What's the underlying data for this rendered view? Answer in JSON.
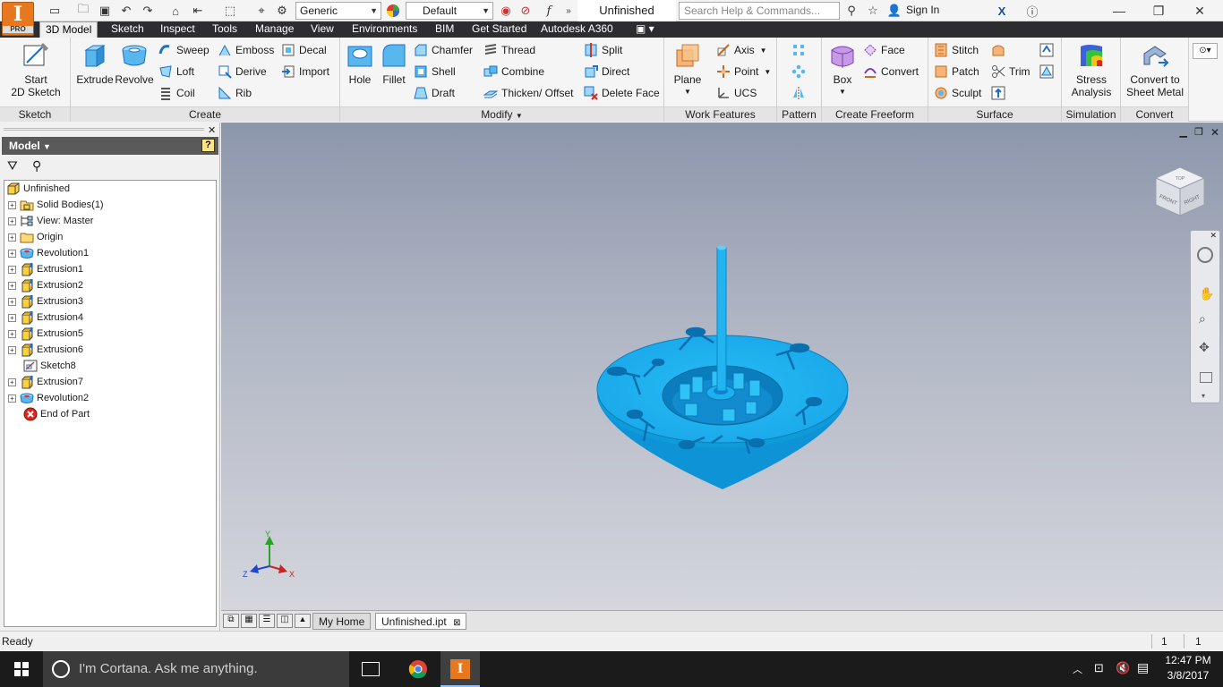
{
  "app": {
    "logo_letter": "I",
    "edition": "PRO"
  },
  "qat": {
    "material": "Generic",
    "appearance": "Default",
    "doc_title": "Unfinished",
    "help_placeholder": "Search Help & Commands...",
    "sign_in": "Sign In"
  },
  "tabs": [
    "3D Model",
    "Sketch",
    "Inspect",
    "Tools",
    "Manage",
    "View",
    "Environments",
    "BIM",
    "Get Started",
    "Autodesk A360"
  ],
  "ribbon": {
    "sketch": {
      "label": "Sketch",
      "start": "Start",
      "start2": "2D Sketch"
    },
    "create": {
      "label": "Create",
      "extrude": "Extrude",
      "revolve": "Revolve",
      "sweep": "Sweep",
      "loft": "Loft",
      "coil": "Coil",
      "emboss": "Emboss",
      "derive": "Derive",
      "rib": "Rib",
      "decal": "Decal",
      "import": "Import"
    },
    "modify": {
      "label": "Modify",
      "hole": "Hole",
      "fillet": "Fillet",
      "chamfer": "Chamfer",
      "shell": "Shell",
      "draft": "Draft",
      "thread": "Thread",
      "combine": "Combine",
      "thicken": "Thicken/ Offset",
      "split": "Split",
      "direct": "Direct",
      "delete_face": "Delete Face"
    },
    "work": {
      "label": "Work Features",
      "plane": "Plane",
      "axis": "Axis",
      "point": "Point",
      "ucs": "UCS"
    },
    "pattern": {
      "label": "Pattern"
    },
    "freeform": {
      "label": "Create Freeform",
      "box": "Box",
      "face": "Face",
      "convert": "Convert"
    },
    "surface": {
      "label": "Surface",
      "stitch": "Stitch",
      "patch": "Patch",
      "sculpt": "Sculpt",
      "trim": "Trim"
    },
    "simulation": {
      "label": "Simulation",
      "stress": "Stress",
      "stress2": "Analysis"
    },
    "convert": {
      "label": "Convert",
      "c1": "Convert to",
      "c2": "Sheet Metal"
    }
  },
  "browser": {
    "title": "Model",
    "root": "Unfinished",
    "nodes": [
      "Solid Bodies(1)",
      "View: Master",
      "Origin",
      "Revolution1",
      "Extrusion1",
      "Extrusion2",
      "Extrusion3",
      "Extrusion4",
      "Extrusion5",
      "Extrusion6",
      "Sketch8",
      "Extrusion7",
      "Revolution2",
      "End of Part"
    ]
  },
  "viewcube": {
    "front": "FRONT",
    "right": "RIGHT",
    "top": "TOP"
  },
  "triad": {
    "x": "X",
    "y": "Y",
    "z": "Z"
  },
  "doc_tabs": {
    "home": "My Home",
    "file": "Unfinished.ipt"
  },
  "status": {
    "text": "Ready",
    "n1": "1",
    "n2": "1"
  },
  "taskbar": {
    "cortana": "I'm Cortana. Ask me anything.",
    "time": "12:47 PM",
    "date": "3/8/2017"
  },
  "colors": {
    "part": "#1fb5f2",
    "part_dark": "#0b8fd0",
    "accent": "#e8781e",
    "ribbon_bg": "#f5f5f5",
    "tab_bar": "#2d2d30"
  }
}
